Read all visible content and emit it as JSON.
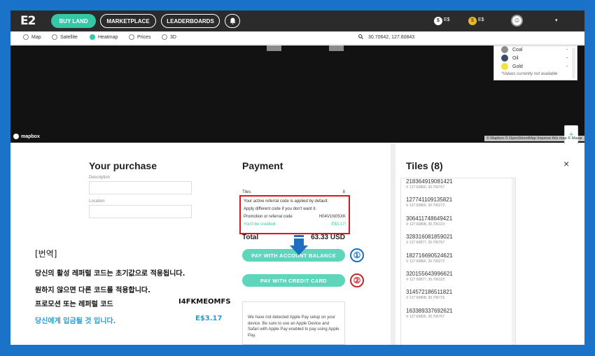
{
  "topbar": {
    "logo": "E2",
    "buy_land": "BUY LAND",
    "marketplace": "MARKETPLACE",
    "leaderboards": "LEADERBOARDS",
    "bell_icon": "bell-icon",
    "currency1_symbol": "$",
    "currency1_label": "E$",
    "currency2_symbol": "$",
    "currency2_label": "E$",
    "avatar_icon": "user-avatar-icon",
    "dropdown": "▾"
  },
  "map_tabs": {
    "items": [
      "Map",
      "Satellite",
      "Heatmap",
      "Prices",
      "3D"
    ],
    "selected": "Heatmap",
    "coords": "30.70642, 127.60843"
  },
  "legend": {
    "items": [
      {
        "name": "Coal",
        "value": "-",
        "color": "#8c8c8c"
      },
      {
        "name": "Oil",
        "value": "-",
        "color": "#3c4a6e"
      },
      {
        "name": "Gold",
        "value": "-",
        "color": "#f4e23a"
      }
    ],
    "note": "*Values currently not available"
  },
  "map": {
    "brand": "mapbox",
    "attribution": "© Mapbox © OpenStreetMap Improve this map © Maxar",
    "zoom_in": "+",
    "zoom_out": "−",
    "layers": "⛗"
  },
  "purchase": {
    "title": "Your purchase",
    "description_label": "Description",
    "location_label": "Location"
  },
  "payment": {
    "title": "Payment",
    "tiles_label": "Tiles",
    "tiles_value": "8",
    "ref_line1": "Your active referral code is applied by default.",
    "ref_line2": "Apply different code if you don't want it.",
    "promo_label": "Promotion or referral code",
    "promo_value": "H04V1N0SXK",
    "credited_label": "You'll be credited",
    "credited_value": "E$3.17!",
    "total_label": "Total",
    "total_value": "63.33 USD",
    "pay_account": "PAY WITH ACCOUNT BALANCE",
    "pay_card": "PAY WITH CREDIT CARD",
    "badge1": "①",
    "badge2": "②",
    "apple_notice": "We have not detected Apple Pay setup on your device. Be sure to use an Apple Device and Safari with Apple Pay enabled to pay using Apple Pay."
  },
  "translation": {
    "title": "[번역]",
    "line1": "당신의 활성 레퍼럴 코드는 초기값으로 적용됩니다.",
    "line2": "원하지 않으면 다른 코드를 적용합니다.",
    "line3": "프로모션 또는 레퍼럴 코드",
    "line3_value": "I4FKMEOMFS",
    "line4": "당신에게 입금될 것 입니다.",
    "line4_value": "E$3.17"
  },
  "tiles_panel": {
    "title": "Tiles (8)",
    "close": "×",
    "items": [
      {
        "id": "218364919081421",
        "coords": "127.60860, 30.706767"
      },
      {
        "id": "127741109135821",
        "coords": "127.60860, 30.706272"
      },
      {
        "id": "306411748649421",
        "coords": "127.60808, 30.706123"
      },
      {
        "id": "328316081859021",
        "coords": "127.60877, 30.706767"
      },
      {
        "id": "182716690524621",
        "coords": "127.60860, 30.706272"
      },
      {
        "id": "320155643996621",
        "coords": "127.60877, 30.706123"
      },
      {
        "id": "314572186511821",
        "coords": "127.60808, 30.706715"
      },
      {
        "id": "163389337692621",
        "coords": "127.60826, 30.706767"
      }
    ]
  }
}
